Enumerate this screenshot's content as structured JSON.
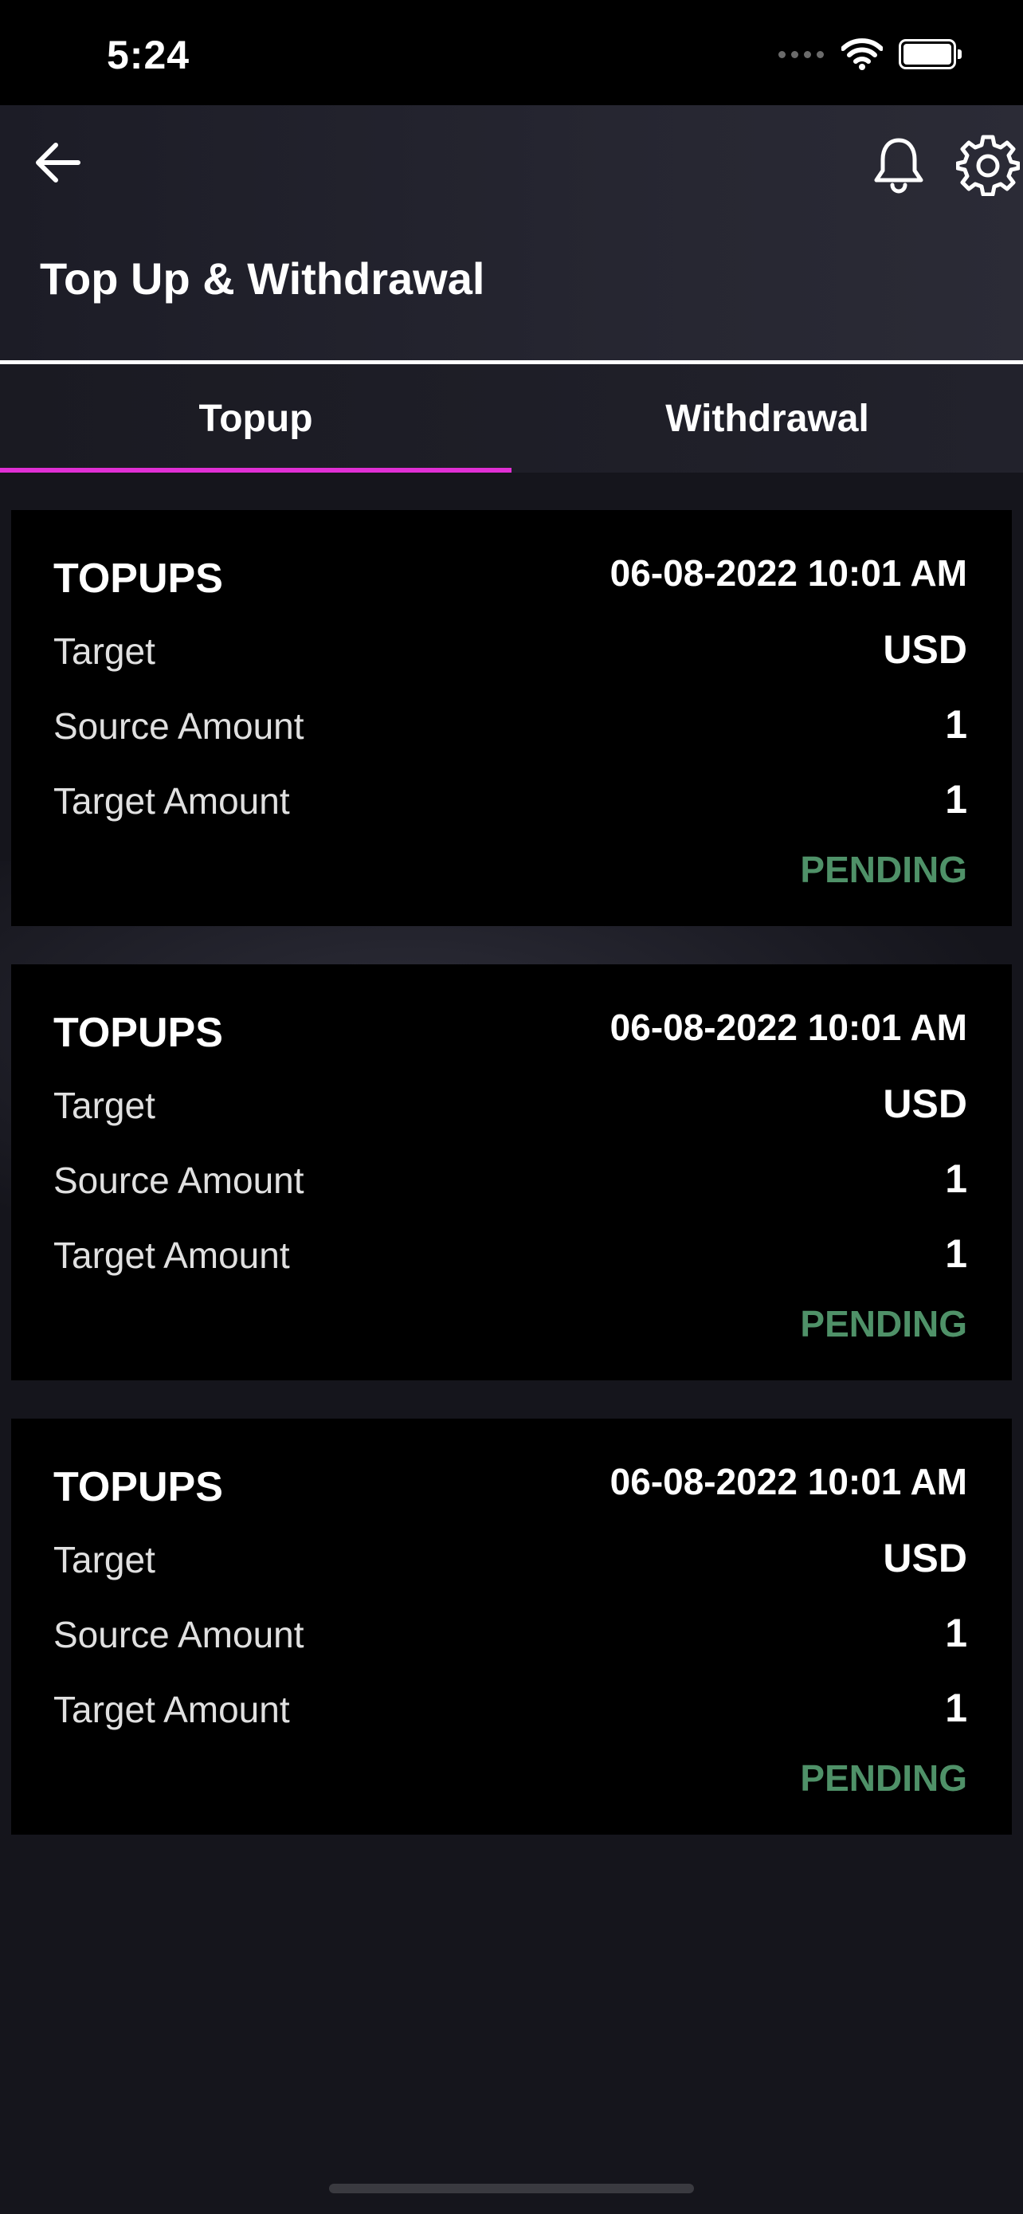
{
  "status_bar": {
    "time": "5:24"
  },
  "header": {
    "title": "Top Up & Withdrawal",
    "icons": [
      "back-arrow-icon",
      "bell-icon",
      "gear-icon"
    ]
  },
  "tabs": [
    {
      "label": "Topup",
      "active": true
    },
    {
      "label": "Withdrawal",
      "active": false
    }
  ],
  "colors": {
    "accent": "#e02fd4",
    "pending": "#4f9168",
    "card_bg": "#000000",
    "page_bg": "#15151c"
  },
  "transactions": [
    {
      "type": "TOPUPS",
      "datetime": "06-08-2022 10:01 AM",
      "target_label": "Target",
      "target_value": "USD",
      "source_amount_label": "Source Amount",
      "source_amount": "1",
      "target_amount_label": "Target Amount",
      "target_amount": "1",
      "status": "PENDING"
    },
    {
      "type": "TOPUPS",
      "datetime": "06-08-2022 10:01 AM",
      "target_label": "Target",
      "target_value": "USD",
      "source_amount_label": "Source Amount",
      "source_amount": "1",
      "target_amount_label": "Target Amount",
      "target_amount": "1",
      "status": "PENDING"
    },
    {
      "type": "TOPUPS",
      "datetime": "06-08-2022 10:01 AM",
      "target_label": "Target",
      "target_value": "USD",
      "source_amount_label": "Source Amount",
      "source_amount": "1",
      "target_amount_label": "Target Amount",
      "target_amount": "1",
      "status": "PENDING"
    }
  ]
}
